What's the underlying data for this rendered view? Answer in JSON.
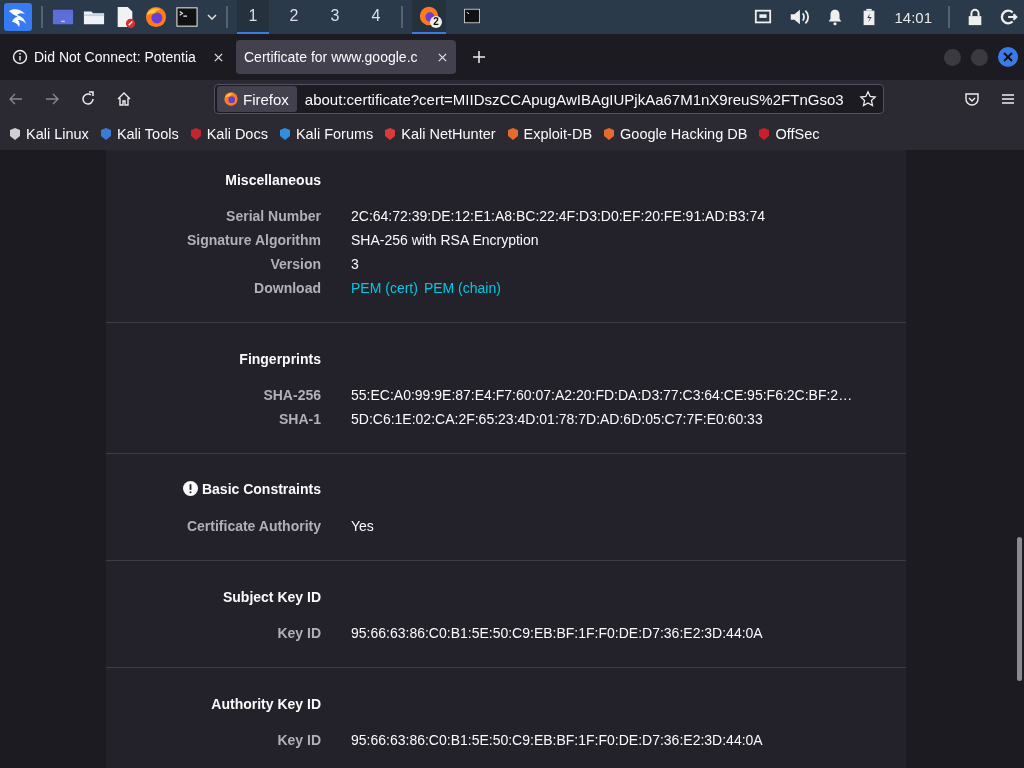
{
  "taskbar": {
    "workspaces": [
      {
        "label": "1",
        "selected": true
      },
      {
        "label": "2",
        "selected": false
      },
      {
        "label": "3",
        "selected": false
      },
      {
        "label": "4",
        "selected": false
      }
    ],
    "tasks": [
      {
        "kind": "firefox",
        "badge": "2",
        "selected": true
      },
      {
        "kind": "terminal",
        "selected": false
      }
    ],
    "clock": "14:01"
  },
  "tabs": [
    {
      "label": "Did Not Connect: Potentia",
      "kind": "error",
      "selected": false
    },
    {
      "label": "Certificate for www.google.c",
      "kind": "page",
      "selected": true
    }
  ],
  "address_bar": {
    "identity": "Firefox",
    "url": "about:certificate?cert=MIIDszCCApugAwIBAgIUPjkAa67M1nX9reuS%2FTnGso3"
  },
  "bookmarks": [
    {
      "label": "Kali Linux",
      "color": "#d0d0d0"
    },
    {
      "label": "Kali Tools",
      "color": "#3a7bd5"
    },
    {
      "label": "Kali Docs",
      "color": "#c0262c"
    },
    {
      "label": "Kali Forums",
      "color": "#2f8fe0"
    },
    {
      "label": "Kali NetHunter",
      "color": "#d93a3a"
    },
    {
      "label": "Exploit-DB",
      "color": "#e8692c"
    },
    {
      "label": "Google Hacking DB",
      "color": "#e8692c"
    },
    {
      "label": "OffSec",
      "color": "#c8202a"
    }
  ],
  "sections": [
    {
      "title": "Miscellaneous",
      "warning": false,
      "rows": [
        {
          "kind": "text",
          "label": "Serial Number",
          "value": "2C:64:72:39:DE:12:E1:A8:BC:22:4F:D3:D0:EF:20:FE:91:AD:B3:74"
        },
        {
          "kind": "text",
          "label": "Signature Algorithm",
          "value": "SHA-256 with RSA Encryption"
        },
        {
          "kind": "text",
          "label": "Version",
          "value": "3"
        },
        {
          "kind": "links",
          "label": "Download",
          "links": [
            "PEM (cert)",
            "PEM (chain)"
          ]
        }
      ]
    },
    {
      "title": "Fingerprints",
      "warning": false,
      "rows": [
        {
          "kind": "text",
          "label": "SHA-256",
          "value": "55:EC:A0:99:9E:87:E4:F7:60:07:A2:20:FD:DA:D3:77:C3:64:CE:95:F6:2C:BF:2…"
        },
        {
          "kind": "text",
          "label": "SHA-1",
          "value": "5D:C6:1E:02:CA:2F:65:23:4D:01:78:7D:AD:6D:05:C7:7F:E0:60:33"
        }
      ]
    },
    {
      "title": "Basic Constraints",
      "warning": true,
      "rows": [
        {
          "kind": "text",
          "label": "Certificate Authority",
          "value": "Yes"
        }
      ]
    },
    {
      "title": "Subject Key ID",
      "warning": false,
      "rows": [
        {
          "kind": "text",
          "label": "Key ID",
          "value": "95:66:63:86:C0:B1:5E:50:C9:EB:BF:1F:F0:DE:D7:36:E2:3D:44:0A"
        }
      ]
    },
    {
      "title": "Authority Key ID",
      "warning": false,
      "rows": [
        {
          "kind": "text",
          "label": "Key ID",
          "value": "95:66:63:86:C0:B1:5E:50:C9:EB:BF:1F:F0:DE:D7:36:E2:3D:44:0A"
        }
      ]
    }
  ]
}
